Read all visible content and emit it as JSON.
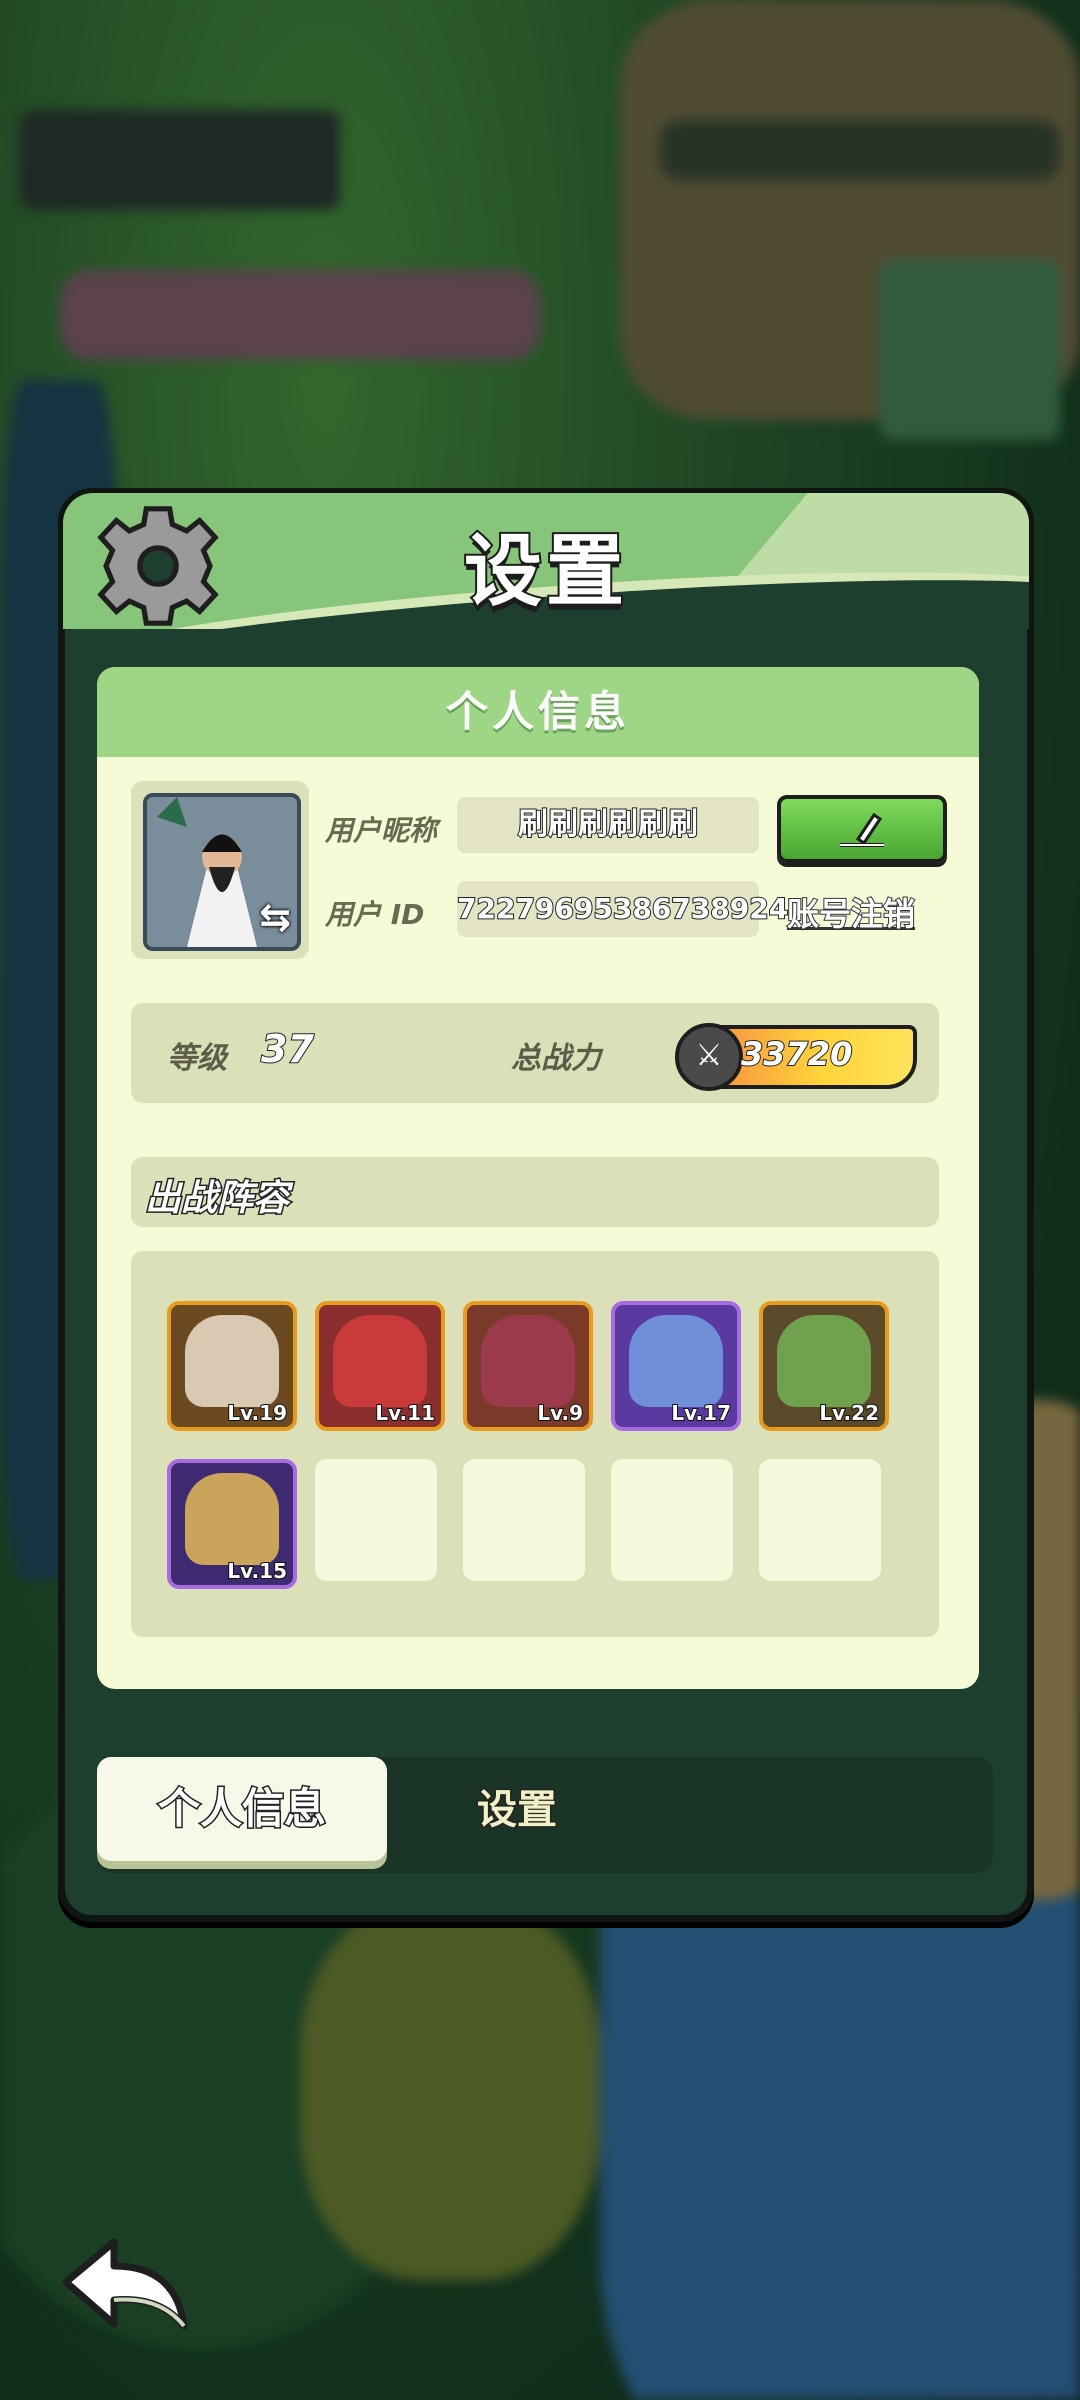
{
  "panel": {
    "title": "设置"
  },
  "profile": {
    "section_title": "个人信息",
    "nickname_label": "用户昵称",
    "nickname": "刷刷刷刷刷刷",
    "id_label": "用户  ID",
    "user_id": "72279695386738924",
    "deregister_label": "账号注销"
  },
  "stats": {
    "level_label": "等级",
    "level": "37",
    "power_label": "总战力",
    "power": "33720"
  },
  "lineup": {
    "title": "出战阵容",
    "heroes": [
      {
        "level": "Lv.19",
        "rarity": "legend",
        "color": "#6b4a22"
      },
      {
        "level": "Lv.11",
        "rarity": "legend",
        "color": "#8a2e2e"
      },
      {
        "level": "Lv.9",
        "rarity": "legend",
        "color": "#7a3a2a"
      },
      {
        "level": "Lv.17",
        "rarity": "epic",
        "color": "#5a3aa0"
      },
      {
        "level": "Lv.22",
        "rarity": "legend",
        "color": "#5b4a2a"
      },
      {
        "level": "Lv.15",
        "rarity": "epic",
        "color": "#3e2a70"
      }
    ],
    "empty_slots": 4
  },
  "tabs": {
    "active": "个人信息",
    "inactive": "设置"
  },
  "colors": {
    "edit_button": "#5cbf3e",
    "card_bg": "#f5fad7",
    "header_green": "#86c57a",
    "legend_frame": "#e79a1c",
    "epic_frame": "#a86be3"
  }
}
